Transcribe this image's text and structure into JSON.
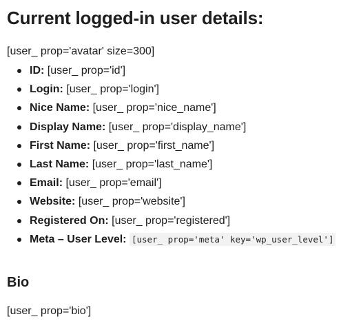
{
  "page": {
    "title": "Current logged-in user details:",
    "avatar_shortcode": "[user_ prop='avatar' size=300]",
    "details": [
      {
        "label": "ID:",
        "value": "[user_ prop='id']"
      },
      {
        "label": "Login:",
        "value": "[user_ prop='login']"
      },
      {
        "label": "Nice Name:",
        "value": "[user_ prop='nice_name']"
      },
      {
        "label": "Display Name:",
        "value": "[user_ prop='display_name']"
      },
      {
        "label": "First Name:",
        "value": "[user_ prop='first_name']"
      },
      {
        "label": "Last Name:",
        "value": "[user_ prop='last_name']"
      },
      {
        "label": "Email:",
        "value": "[user_ prop='email']"
      },
      {
        "label": "Website:",
        "value": "[user_ prop='website']"
      },
      {
        "label": "Registered On:",
        "value": "[user_ prop='registered']"
      },
      {
        "label": "Meta – User Level:",
        "value": "[user_ prop='meta' key='wp_user_level']"
      }
    ],
    "bio_heading": "Bio",
    "bio_shortcode": "[user_ prop='bio']"
  }
}
